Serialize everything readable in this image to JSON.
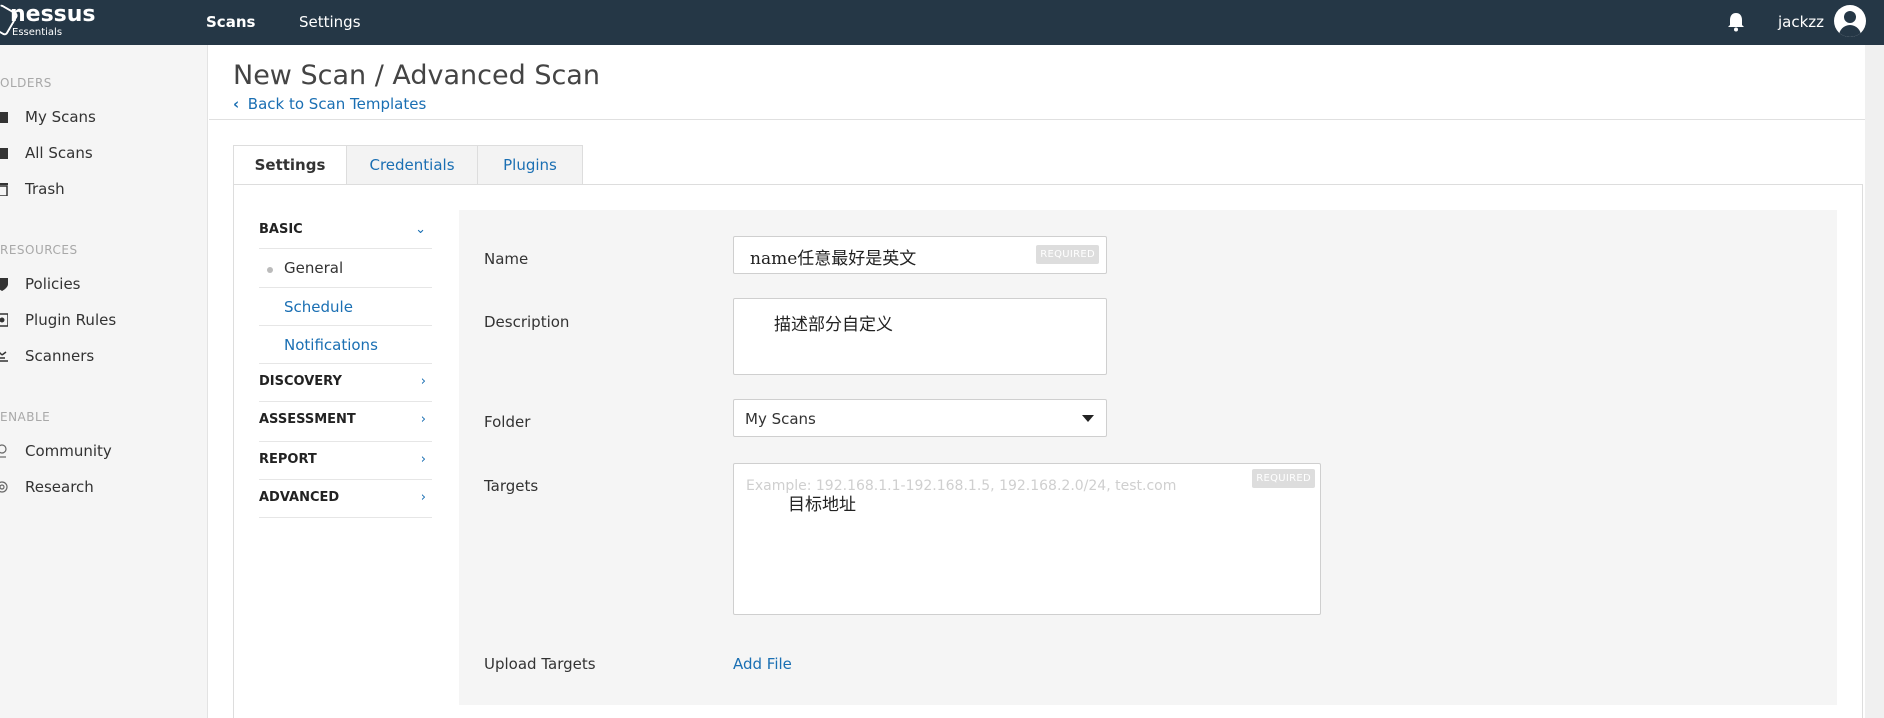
{
  "app": {
    "brand": "nessus",
    "edition": "Essentials"
  },
  "topnav": {
    "scans": "Scans",
    "settings": "Settings",
    "username": "jackzz"
  },
  "sidebar": {
    "sections": [
      {
        "label": "OLDERS"
      },
      {
        "label": "RESOURCES"
      },
      {
        "label": "ENABLE"
      }
    ],
    "items": [
      {
        "label": "My Scans",
        "icon": "folder-icon"
      },
      {
        "label": "All Scans",
        "icon": "folder-icon"
      },
      {
        "label": "Trash",
        "icon": "trash-icon"
      },
      {
        "label": "Policies",
        "icon": "shield-icon"
      },
      {
        "label": "Plugin Rules",
        "icon": "plugin-rules-icon"
      },
      {
        "label": "Scanners",
        "icon": "scanner-icon"
      },
      {
        "label": "Community",
        "icon": "community-icon"
      },
      {
        "label": "Research",
        "icon": "research-icon"
      }
    ]
  },
  "page": {
    "title": "New Scan / Advanced Scan",
    "back_link": "Back to Scan Templates"
  },
  "tabs": [
    {
      "label": "Settings",
      "active": true
    },
    {
      "label": "Credentials",
      "active": false
    },
    {
      "label": "Plugins",
      "active": false
    }
  ],
  "inner_menu": {
    "basic": "BASIC",
    "general": "General",
    "schedule": "Schedule",
    "notifications": "Notifications",
    "discovery": "DISCOVERY",
    "assessment": "ASSESSMENT",
    "report": "REPORT",
    "advanced": "ADVANCED"
  },
  "form": {
    "name_label": "Name",
    "name_value": "name任意最好是英文",
    "required_badge": "REQUIRED",
    "description_label": "Description",
    "description_value": "描述部分自定义",
    "folder_label": "Folder",
    "folder_value": "My Scans",
    "targets_label": "Targets",
    "targets_placeholder": "Example: 192.168.1.1-192.168.1.5, 192.168.2.0/24, test.com",
    "targets_value": "目标地址",
    "upload_label": "Upload Targets",
    "add_file": "Add File"
  },
  "colors": {
    "topbar": "#253746",
    "link": "#1a6fb3",
    "panel": "#f5f5f5"
  }
}
